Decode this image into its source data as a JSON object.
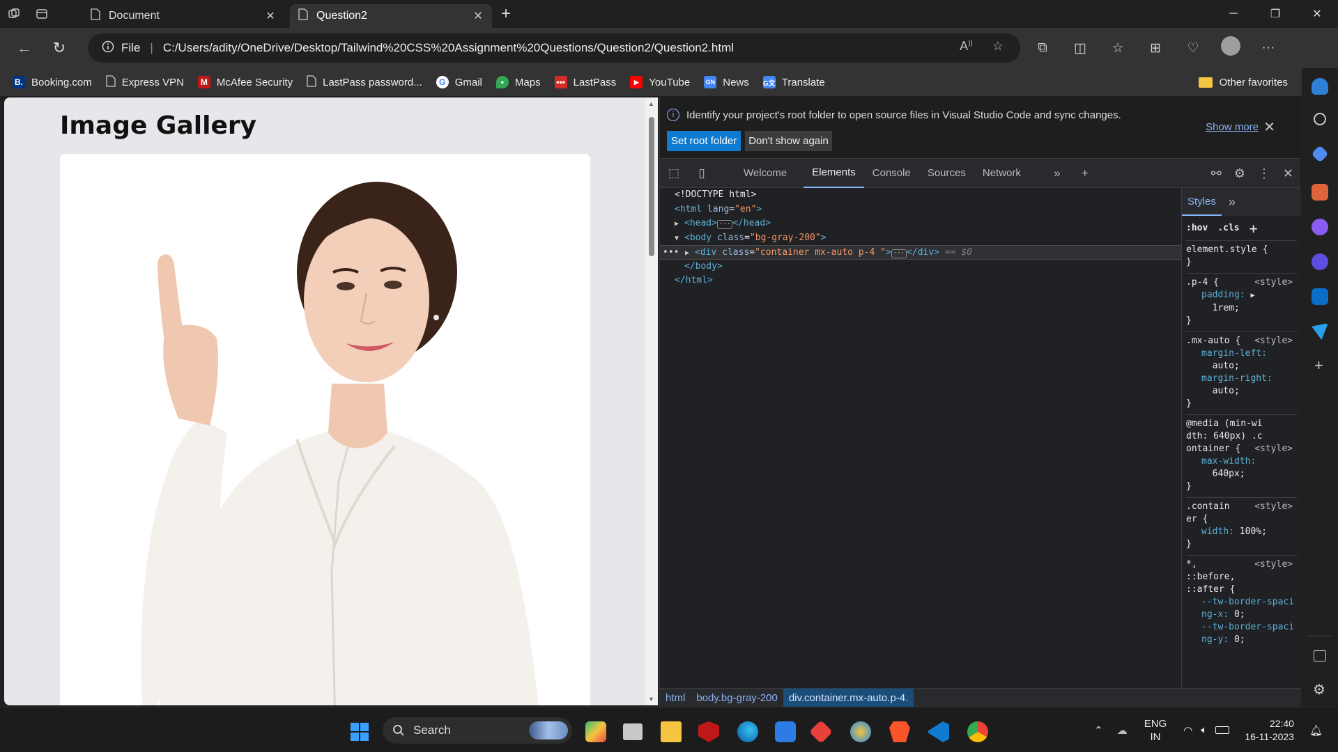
{
  "browser": {
    "tabs": [
      {
        "title": "Document",
        "active": false
      },
      {
        "title": "Question2",
        "active": true
      }
    ],
    "address": {
      "scheme_label": "File",
      "url": "C:/Users/adity/OneDrive/Desktop/Tailwind%20CSS%20Assignment%20Questions/Question2/Question2.html"
    },
    "favorites": [
      {
        "label": "Booking.com",
        "icon": "booking-icon",
        "color": "#003580"
      },
      {
        "label": "Express VPN",
        "icon": "page-icon",
        "color": ""
      },
      {
        "label": "McAfee Security",
        "icon": "mcafee-icon",
        "color": "#c01818"
      },
      {
        "label": "LastPass password...",
        "icon": "page-icon",
        "color": ""
      },
      {
        "label": "Gmail",
        "icon": "google-icon",
        "color": "#ffffff"
      },
      {
        "label": "Maps",
        "icon": "maps-icon",
        "color": "#34a853"
      },
      {
        "label": "LastPass",
        "icon": "lastpass-icon",
        "color": "#d32d27"
      },
      {
        "label": "YouTube",
        "icon": "youtube-icon",
        "color": "#ff0000"
      },
      {
        "label": "News",
        "icon": "news-icon",
        "color": "#4285f4"
      },
      {
        "label": "Translate",
        "icon": "translate-icon",
        "color": "#4285f4"
      }
    ],
    "other_favorites": "Other favorites"
  },
  "page": {
    "heading": "Image Gallery"
  },
  "devtools": {
    "infobar": {
      "message": "Identify your project's root folder to open source files in Visual Studio Code and sync changes.",
      "set_root": "Set root folder",
      "dont_show": "Don't show again",
      "show_more": "Show more"
    },
    "tabs": [
      "Welcome",
      "Elements",
      "Console",
      "Sources",
      "Network"
    ],
    "active_tab": "Elements",
    "dom": {
      "doctype": "<!DOCTYPE html>",
      "html_open": "<html",
      "html_lang_attr": "lang",
      "html_lang_val": "\"en\"",
      "head_open": "<head>",
      "head_close": "</head>",
      "body_open": "<body",
      "body_class_attr": "class",
      "body_class_val": "\"bg-gray-200\"",
      "div_open": "<div",
      "div_class_attr": "class",
      "div_class_val": "\"container mx-auto p-4 \"",
      "div_close": "</div>",
      "div_marker": "== $0",
      "body_close": "</body>",
      "html_close": "</html>"
    },
    "styles": {
      "tab": "Styles",
      "hov": ":hov",
      "cls": ".cls",
      "rules": [
        {
          "selector": "element.style {",
          "source": "",
          "props": [],
          "close": "}"
        },
        {
          "selector": ".p-4 {",
          "source": "<style>",
          "props": [
            {
              "name": "padding:",
              "value": "1rem;"
            }
          ],
          "close": "}"
        },
        {
          "selector": ".mx-auto {",
          "source": "<style>",
          "props": [
            {
              "name": "margin-left:",
              "value": "auto;"
            },
            {
              "name": "margin-right:",
              "value": "auto;"
            }
          ],
          "close": "}"
        },
        {
          "selector": "@media (min-width: 640px) .container {",
          "source": "<style>",
          "props": [
            {
              "name": "max-width:",
              "value": "640px;"
            }
          ],
          "close": "}"
        },
        {
          "selector": ".container {",
          "source": "<style>",
          "props": [
            {
              "name": "width:",
              "value": "100%;"
            }
          ],
          "close": "}"
        },
        {
          "selector": "*, ::before, ::after {",
          "source": "<style>",
          "props": [
            {
              "name": "--tw-border-spacing-x:",
              "value": "0;"
            },
            {
              "name": "--tw-border-spacing-y:",
              "value": "0;"
            }
          ],
          "close": ""
        }
      ]
    },
    "breadcrumb": [
      "html",
      "body.bg-gray-200",
      "div.container.mx-auto.p-4."
    ]
  },
  "taskbar": {
    "search_placeholder": "Search",
    "lang_line1": "ENG",
    "lang_line2": "IN",
    "time": "22:40",
    "date": "16-11-2023"
  },
  "colors": {
    "accent": "#0e7ad0",
    "page_bg": "#e5e7eb",
    "devtools_bg": "#202124"
  }
}
